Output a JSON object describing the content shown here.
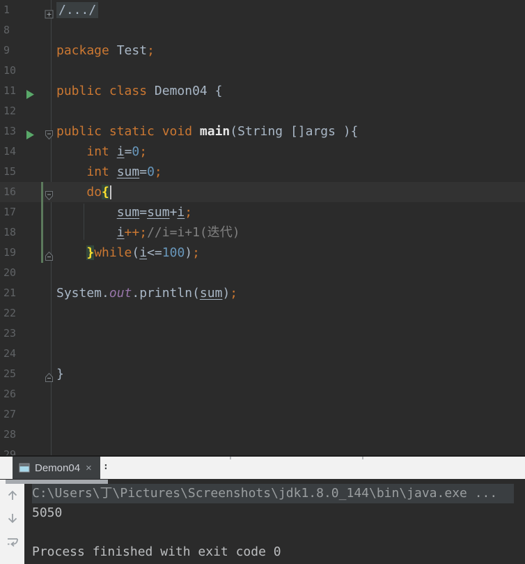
{
  "editor": {
    "lines": [
      {
        "num": "1",
        "fold": "plus",
        "tokens": [
          [
            "fold",
            "/.../"
          ]
        ]
      },
      {
        "num": "8",
        "tokens": []
      },
      {
        "num": "9",
        "tokens": [
          [
            "kw",
            "package "
          ],
          [
            "pl",
            "Test"
          ],
          [
            "semi",
            ";"
          ]
        ]
      },
      {
        "num": "10",
        "tokens": []
      },
      {
        "num": "11",
        "run": true,
        "tokens": [
          [
            "kw",
            "public class "
          ],
          [
            "pl",
            "Demon04 {"
          ]
        ]
      },
      {
        "num": "12",
        "tokens": []
      },
      {
        "num": "13",
        "run": true,
        "fold": "down",
        "tokens": [
          [
            "kw",
            "public static void "
          ],
          [
            "main",
            "main"
          ],
          [
            "pl",
            "(String []args ){"
          ]
        ]
      },
      {
        "num": "14",
        "tokens": [
          [
            "pl",
            "    "
          ],
          [
            "kw",
            "int "
          ],
          [
            "varu",
            "i"
          ],
          [
            "pl",
            "="
          ],
          [
            "num",
            "0"
          ],
          [
            "semi",
            ";"
          ]
        ]
      },
      {
        "num": "15",
        "tokens": [
          [
            "pl",
            "    "
          ],
          [
            "kw",
            "int "
          ],
          [
            "varu",
            "sum"
          ],
          [
            "pl",
            "="
          ],
          [
            "num",
            "0"
          ],
          [
            "semi",
            ";"
          ]
        ]
      },
      {
        "num": "16",
        "fold": "down",
        "current": true,
        "caret": true,
        "tokens": [
          [
            "pl",
            "    "
          ],
          [
            "kw",
            "do"
          ],
          [
            "brhl",
            "{"
          ]
        ]
      },
      {
        "num": "17",
        "tokens": [
          [
            "pl",
            "        "
          ],
          [
            "varu",
            "sum"
          ],
          [
            "pl",
            "="
          ],
          [
            "varu",
            "sum"
          ],
          [
            "pl",
            "+"
          ],
          [
            "varu",
            "i"
          ],
          [
            "semi",
            ";"
          ]
        ]
      },
      {
        "num": "18",
        "tokens": [
          [
            "pl",
            "        "
          ],
          [
            "varu",
            "i"
          ],
          [
            "kw",
            "++"
          ],
          [
            "semi",
            ";"
          ],
          [
            "cmt",
            "//i=i+1(迭代)"
          ]
        ]
      },
      {
        "num": "19",
        "fold": "up",
        "tokens": [
          [
            "pl",
            "    "
          ],
          [
            "brhl",
            "}"
          ],
          [
            "kw",
            "while"
          ],
          [
            "pl",
            "("
          ],
          [
            "varu",
            "i"
          ],
          [
            "pl",
            "<="
          ],
          [
            "num",
            "100"
          ],
          [
            "pl",
            ")"
          ],
          [
            "semi",
            ";"
          ]
        ]
      },
      {
        "num": "20",
        "tokens": []
      },
      {
        "num": "21",
        "tokens": [
          [
            "pl",
            "System."
          ],
          [
            "field",
            "out"
          ],
          [
            "pl",
            ".println("
          ],
          [
            "varu",
            "sum"
          ],
          [
            "pl",
            ")"
          ],
          [
            "semi",
            ";"
          ]
        ]
      },
      {
        "num": "22",
        "tokens": []
      },
      {
        "num": "23",
        "tokens": []
      },
      {
        "num": "24",
        "tokens": []
      },
      {
        "num": "25",
        "fold": "up",
        "tokens": [
          [
            "pl",
            "}"
          ]
        ]
      },
      {
        "num": "26",
        "tokens": []
      },
      {
        "num": "27",
        "tokens": []
      },
      {
        "num": "28",
        "tokens": []
      },
      {
        "num": "29",
        "tokens": []
      }
    ],
    "vcs_change": {
      "from_line": "16",
      "to_line": "19"
    },
    "colors": {
      "background": "#2b2b2b",
      "current_line": "#323232",
      "keyword": "#cc7832",
      "number": "#6897bb",
      "plain": "#a9b7c6",
      "comment": "#808080",
      "field": "#9876aa",
      "matched_brace": "#ffe32e",
      "matched_brace_bg": "#32473b",
      "run_arrow": "#59a869",
      "vcs_added": "#5c7a5c",
      "line_number": "#606366"
    }
  },
  "run_panel": {
    "tab": {
      "label": "Demon04",
      "close_glyph": "×",
      "edge_mark": ":"
    },
    "toolbar_icons": [
      "scroll-to-top",
      "scroll-to-bottom",
      "soft-wrap"
    ],
    "console": {
      "lines": [
        {
          "style": "command",
          "text": "C:\\Users\\丁\\Pictures\\Screenshots\\jdk1.8.0_144\\bin\\java.exe ..."
        },
        {
          "style": "stdout",
          "text": "5050"
        },
        {
          "style": "stdout",
          "text": ""
        },
        {
          "style": "system",
          "text": "Process finished with exit code 0"
        }
      ]
    }
  }
}
